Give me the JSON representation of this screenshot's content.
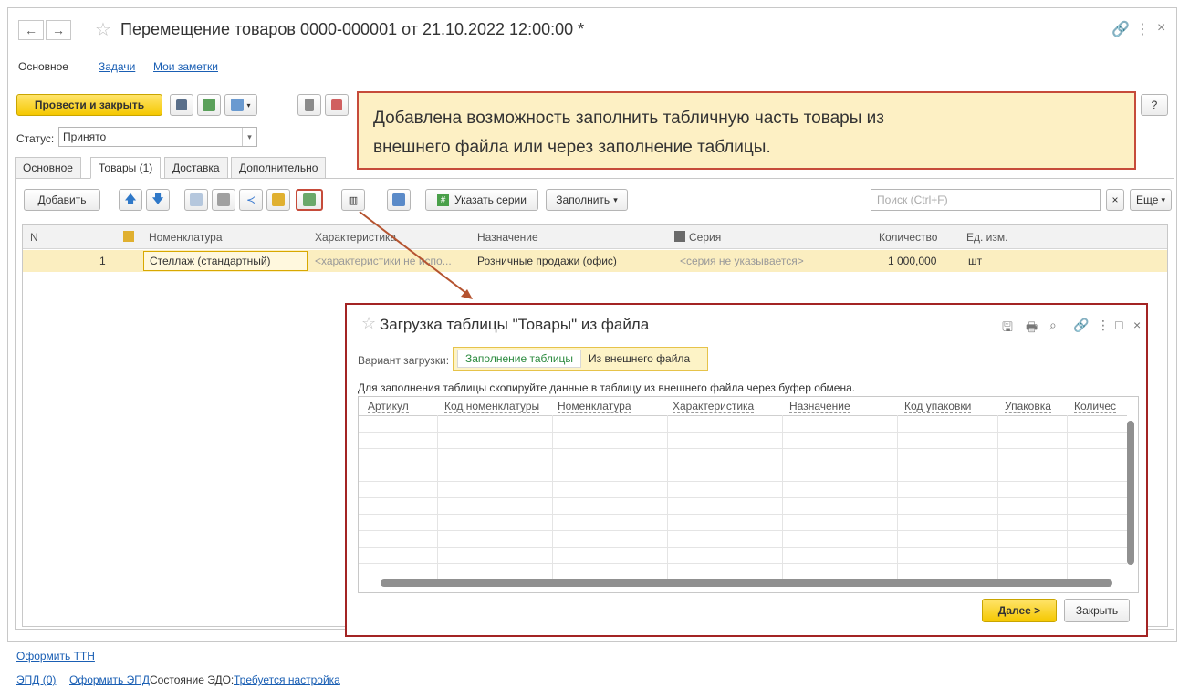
{
  "window": {
    "title": "Перемещение товаров 0000-000001 от 21.10.2022 12:00:00 *"
  },
  "section_nav": [
    {
      "label": "Основное"
    },
    {
      "label": "Задачи"
    },
    {
      "label": "Мои заметки"
    }
  ],
  "toolbar": {
    "post_close_label": "Провести и закрыть",
    "more_label": "Еще",
    "help_label": "?"
  },
  "status": {
    "label": "Статус:",
    "value": "Принято"
  },
  "tabs": [
    {
      "label": "Основное"
    },
    {
      "label": "Товары (1)"
    },
    {
      "label": "Доставка"
    },
    {
      "label": "Дополнительно"
    }
  ],
  "goods_toolbar": {
    "add_label": "Добавить",
    "series_label": "Указать серии",
    "fill_label": "Заполнить",
    "search_placeholder": "Поиск (Ctrl+F)",
    "clear_label": "×",
    "more_label": "Еще"
  },
  "grid": {
    "columns": [
      "N",
      "Номенклатура",
      "Характеристика",
      "Назначение",
      "Серия",
      "Количество",
      "Ед. изм."
    ],
    "rows": [
      {
        "n": "1",
        "item": "Стеллаж (стандартный)",
        "characteristic": "<характеристики не испо...",
        "purpose": "Розничные продажи (офис)",
        "series": "<серия не указывается>",
        "quantity": "1 000,000",
        "unit": "шт"
      }
    ]
  },
  "callout": {
    "line1": "Добавлена возможность заполнить табличную часть товары из",
    "line2": "внешнего файла или через заполнение таблицы."
  },
  "modal": {
    "title": "Загрузка таблицы \"Товары\" из файла",
    "variant_label": "Вариант загрузки:",
    "options": [
      {
        "label": "Заполнение таблицы",
        "active": true
      },
      {
        "label": "Из внешнего файла",
        "active": false
      }
    ],
    "hint": "Для заполнения таблицы скопируйте данные в таблицу из внешнего файла через буфер обмена.",
    "columns": [
      "Артикул",
      "Код номенклатуры",
      "Номенклатура",
      "Характеристика",
      "Назначение",
      "Код упаковки",
      "Упаковка",
      "Количес"
    ],
    "next_label": "Далее >",
    "close_label": "Закрыть"
  },
  "footer": {
    "ttn_link": "Оформить ТТН",
    "epd_count": "ЭПД (0)",
    "epd_link": "Оформить ЭПД",
    "edo_label": "Состояние ЭДО:",
    "edo_link": "Требуется настройка"
  },
  "colors": {
    "primary_button": "#f5c800",
    "highlight_row": "#fbeec0",
    "callout_bg": "#fdf0c4",
    "callout_border": "#c64b3a",
    "modal_border": "#a32424",
    "link": "#1a5fb4"
  }
}
